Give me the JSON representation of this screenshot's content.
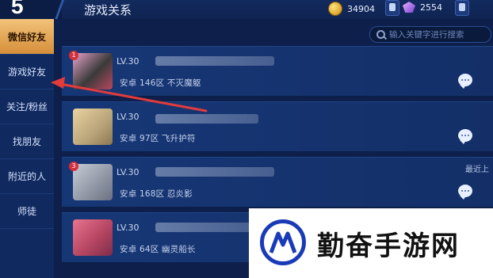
{
  "header": {
    "back_number": "5",
    "title": "游戏关系",
    "coins": "34904",
    "gems": "2554"
  },
  "sidebar": {
    "items": [
      {
        "label": "微信好友",
        "active": true
      },
      {
        "label": "游戏好友",
        "active": false
      },
      {
        "label": "关注/粉丝",
        "active": false
      },
      {
        "label": "找朋友",
        "active": false
      },
      {
        "label": "附近的人",
        "active": false
      },
      {
        "label": "师徒",
        "active": false
      }
    ]
  },
  "search": {
    "placeholder": "输入关键字进行搜索"
  },
  "friends": [
    {
      "level": "LV.30",
      "info": "安卓 146区 不灭魔躯",
      "badge": "1",
      "recent": ""
    },
    {
      "level": "LV.30",
      "info": "安卓 97区 飞升护符",
      "badge": "",
      "recent": ""
    },
    {
      "level": "LV.30",
      "info": "安卓 168区 忍炎影",
      "badge": "3",
      "recent": "最近上"
    },
    {
      "level": "LV.30",
      "info": "安卓 64区 幽灵船长",
      "badge": "",
      "recent": ""
    }
  ],
  "watermark": {
    "brand_text": "勤奋手游网"
  },
  "colors": {
    "accent_active": "#e0a24f",
    "background": "#0d1f4a",
    "annotation_arrow": "#e33b3b"
  }
}
